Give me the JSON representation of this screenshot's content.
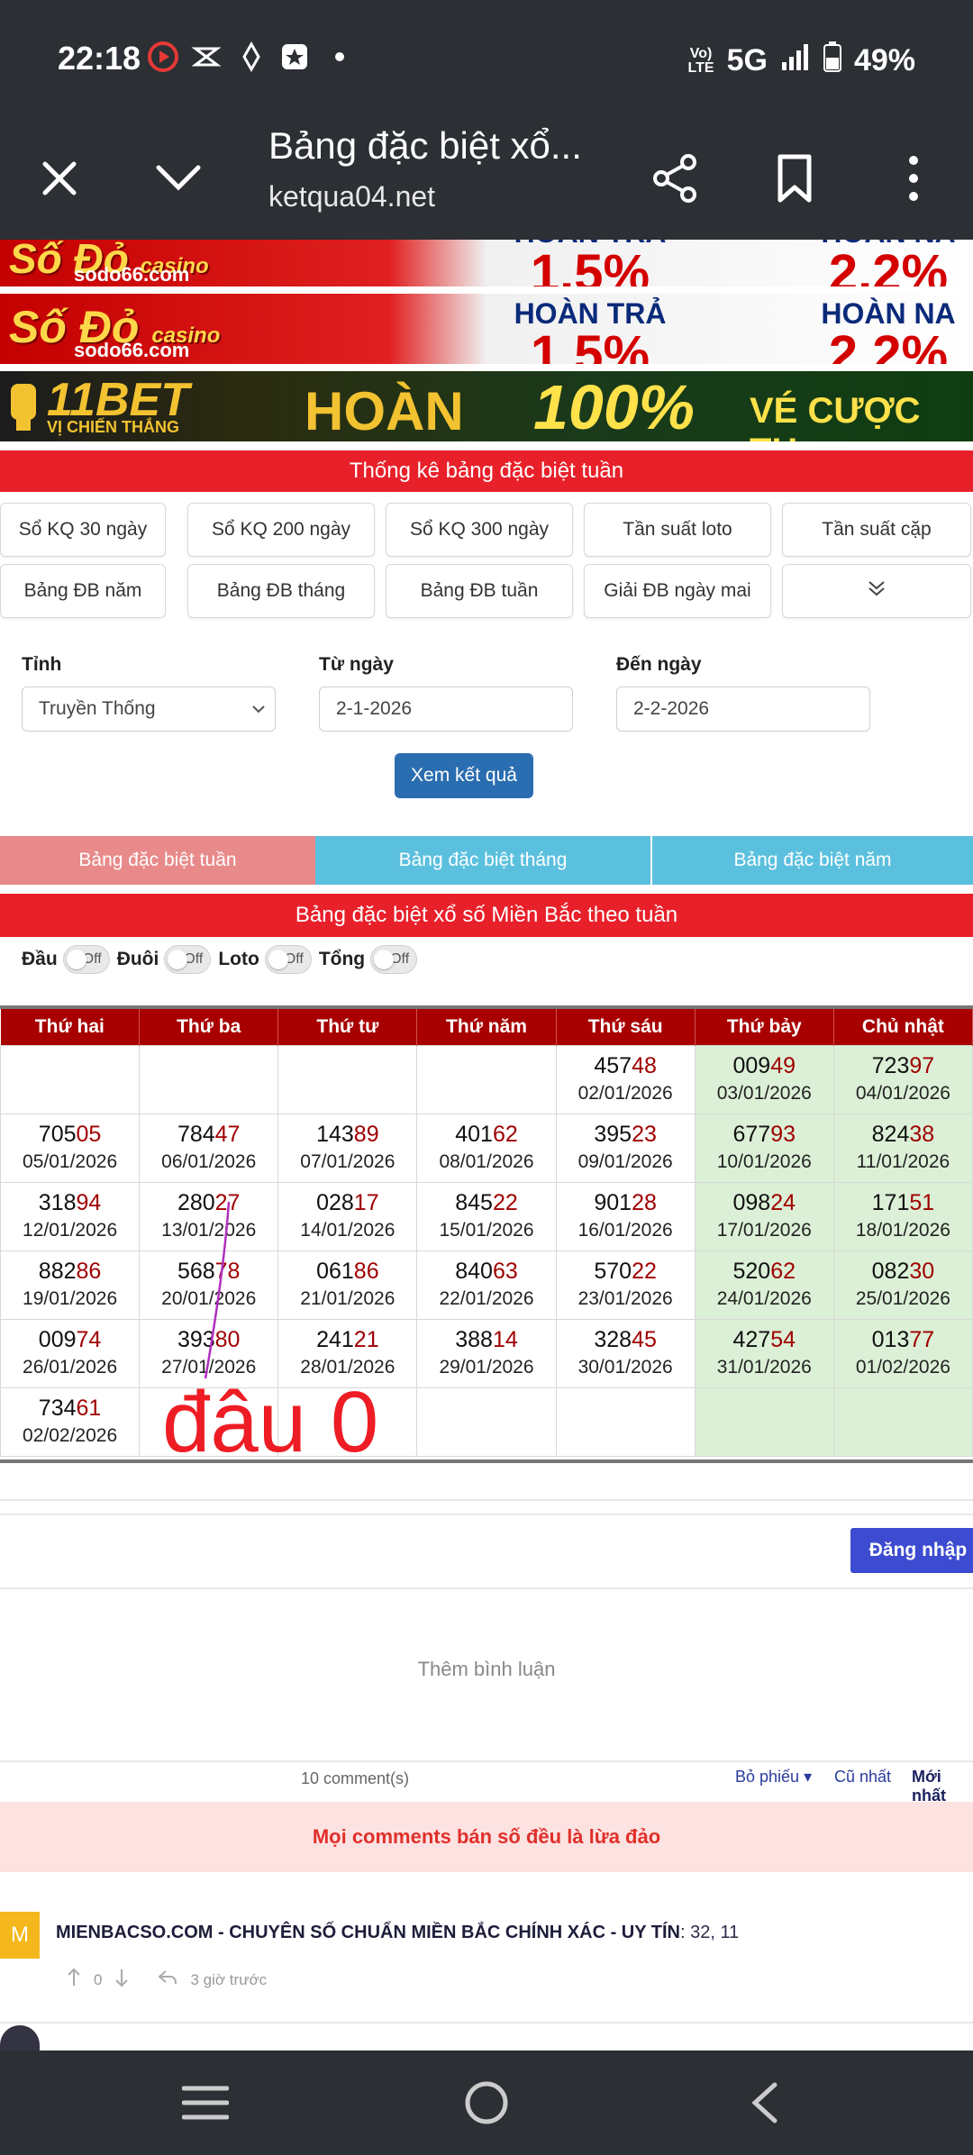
{
  "status": {
    "time": "22:18",
    "network": "5G",
    "battery": "49%"
  },
  "browser": {
    "title": "Bảng đặc biệt xổ...",
    "url": "ketqua04.net"
  },
  "banners": {
    "sodo_brand": "Số Đỏ",
    "sodo_casino": "casino",
    "sodo_site": "sodo66.com",
    "hoan_tra": "HOÀN TRẢ",
    "hoan_tra_pct": "1.5%",
    "hoan_na": "HOÀN NA",
    "hoan_na_pct": "2.2%",
    "bet_brand": "11BET",
    "bet_slogan": "VỊ CHIẾN THẮNG",
    "bet_hoan": "HOÀN",
    "bet_pct": "100%",
    "bet_ve": "VÉ CƯỢC TH"
  },
  "stats_header": "Thống kê bảng đặc biệt tuần",
  "nav_buttons": [
    "Sổ KQ 30 ngày",
    "Sổ KQ 200 ngày",
    "Sổ KQ 300 ngày",
    "Tần suất loto",
    "Tần suất cặp",
    "Bảng ĐB năm",
    "Bảng ĐB tháng",
    "Bảng ĐB tuần",
    "Giải ĐB ngày mai"
  ],
  "form": {
    "province_label": "Tỉnh",
    "province_value": "Truyền Thống",
    "from_label": "Từ ngày",
    "from_value": "2-1-2026",
    "to_label": "Đến ngày",
    "to_value": "2-2-2026",
    "submit": "Xem kết quả"
  },
  "tabs": [
    "Bảng đặc biệt tuần",
    "Bảng đặc biệt tháng",
    "Bảng đặc biệt năm"
  ],
  "table_header": "Bảng đặc biệt xổ số Miền Bắc theo tuần",
  "toggles": [
    {
      "label": "Đầu",
      "state": "Off"
    },
    {
      "label": "Đuôi",
      "state": "Off"
    },
    {
      "label": "Loto",
      "state": "Off"
    },
    {
      "label": "Tổng",
      "state": "Off"
    }
  ],
  "weekdays": [
    "Thứ hai",
    "Thứ ba",
    "Thứ tư",
    "Thứ năm",
    "Thứ sáu",
    "Thứ bảy",
    "Chủ nhật"
  ],
  "weeks": [
    [
      null,
      null,
      null,
      null,
      {
        "n": "457",
        "h": "48",
        "d": "02/01/2026"
      },
      {
        "n": "009",
        "h": "49",
        "d": "03/01/2026"
      },
      {
        "n": "723",
        "h": "97",
        "d": "04/01/2026"
      }
    ],
    [
      {
        "n": "705",
        "h": "05",
        "d": "05/01/2026"
      },
      {
        "n": "784",
        "h": "47",
        "d": "06/01/2026"
      },
      {
        "n": "143",
        "h": "89",
        "d": "07/01/2026"
      },
      {
        "n": "401",
        "h": "62",
        "d": "08/01/2026"
      },
      {
        "n": "395",
        "h": "23",
        "d": "09/01/2026"
      },
      {
        "n": "677",
        "h": "93",
        "d": "10/01/2026"
      },
      {
        "n": "824",
        "h": "38",
        "d": "11/01/2026"
      }
    ],
    [
      {
        "n": "318",
        "h": "94",
        "d": "12/01/2026"
      },
      {
        "n": "280",
        "h": "27",
        "d": "13/01/2026"
      },
      {
        "n": "028",
        "h": "17",
        "d": "14/01/2026"
      },
      {
        "n": "845",
        "h": "22",
        "d": "15/01/2026"
      },
      {
        "n": "901",
        "h": "28",
        "d": "16/01/2026"
      },
      {
        "n": "098",
        "h": "24",
        "d": "17/01/2026"
      },
      {
        "n": "171",
        "h": "51",
        "d": "18/01/2026"
      }
    ],
    [
      {
        "n": "882",
        "h": "86",
        "d": "19/01/2026"
      },
      {
        "n": "568",
        "h": "78",
        "d": "20/01/2026"
      },
      {
        "n": "061",
        "h": "86",
        "d": "21/01/2026"
      },
      {
        "n": "840",
        "h": "63",
        "d": "22/01/2026"
      },
      {
        "n": "570",
        "h": "22",
        "d": "23/01/2026"
      },
      {
        "n": "520",
        "h": "62",
        "d": "24/01/2026"
      },
      {
        "n": "082",
        "h": "30",
        "d": "25/01/2026"
      }
    ],
    [
      {
        "n": "009",
        "h": "74",
        "d": "26/01/2026"
      },
      {
        "n": "393",
        "h": "80",
        "d": "27/01/2026"
      },
      {
        "n": "241",
        "h": "21",
        "d": "28/01/2026"
      },
      {
        "n": "388",
        "h": "14",
        "d": "29/01/2026"
      },
      {
        "n": "328",
        "h": "45",
        "d": "30/01/2026"
      },
      {
        "n": "427",
        "h": "54",
        "d": "31/01/2026"
      },
      {
        "n": "013",
        "h": "77",
        "d": "01/02/2026"
      }
    ],
    [
      {
        "n": "734",
        "h": "61",
        "d": "02/02/2026"
      },
      null,
      null,
      null,
      null,
      null,
      null
    ]
  ],
  "handwriting": "đâu 0",
  "comments": {
    "login": "Đăng nhập",
    "add": "Thêm bình luận",
    "count": "10 comment(s)",
    "sort_vote": "Bỏ phiếu",
    "sort_old": "Cũ nhất",
    "sort_new": "Mới nhất",
    "warning": "Mọi comments bán số đều là lừa đảo",
    "first": {
      "avatar": "M",
      "author": "MIENBACSO.COM - CHUYÊN SỐ CHUẨN MIỀN BẮC CHÍNH XÁC - UY TÍN",
      "body": ": 32, 11",
      "votes": "0",
      "time": "3 giờ trước"
    }
  },
  "colors": {
    "red_header": "#e8202a",
    "table_head": "#a80000",
    "weekend": "#dbf0d6",
    "tab_active": "#e88a8a",
    "tab_inactive": "#5bc0de",
    "submit": "#2a6db0",
    "login": "#3c4bd0"
  }
}
